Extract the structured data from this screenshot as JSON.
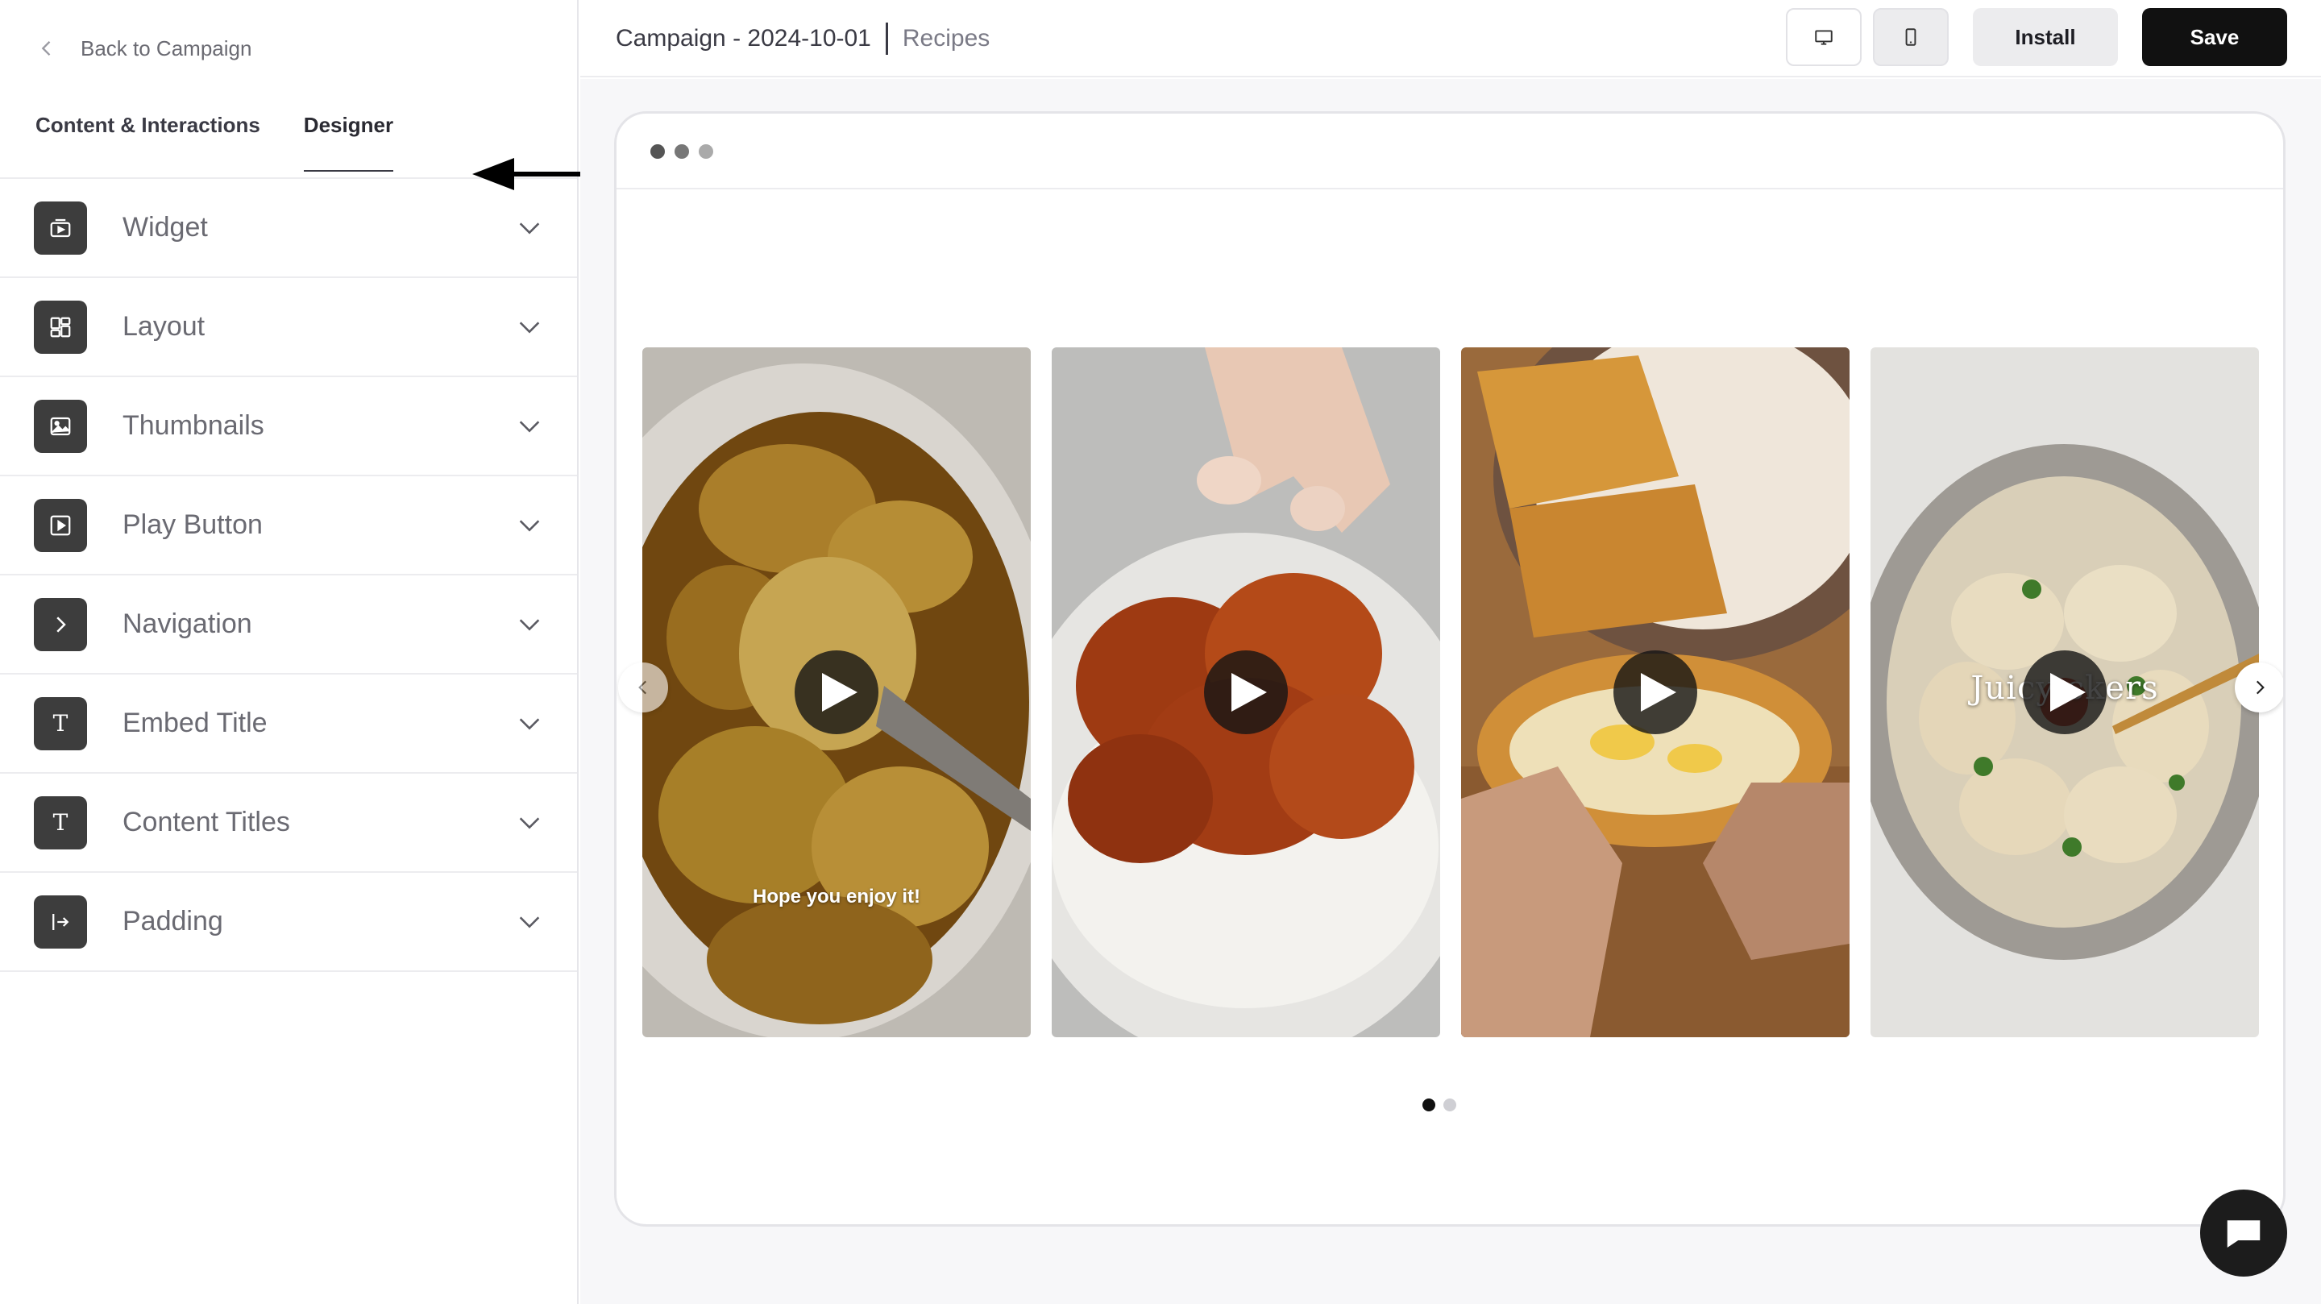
{
  "sidebar": {
    "back_label": "Back to Campaign",
    "tabs": [
      {
        "label": "Content & Interactions",
        "active": false
      },
      {
        "label": "Designer",
        "active": true
      }
    ],
    "items": [
      {
        "label": "Widget",
        "icon": "widget-icon"
      },
      {
        "label": "Layout",
        "icon": "layout-icon"
      },
      {
        "label": "Thumbnails",
        "icon": "thumbnail-icon"
      },
      {
        "label": "Play Button",
        "icon": "play-button-icon"
      },
      {
        "label": "Navigation",
        "icon": "navigation-icon"
      },
      {
        "label": "Embed Title",
        "icon": "text-icon"
      },
      {
        "label": "Content Titles",
        "icon": "text-icon"
      },
      {
        "label": "Padding",
        "icon": "padding-icon"
      }
    ]
  },
  "header": {
    "campaign": "Campaign - 2024-10-01",
    "page": "Recipes",
    "install_label": "Install",
    "save_label": "Save"
  },
  "preview": {
    "cards": [
      {
        "caption": "Hope you enjoy it!",
        "overlay": ""
      },
      {
        "caption": "",
        "overlay": ""
      },
      {
        "caption": "",
        "overlay": ""
      },
      {
        "caption": "",
        "overlay": "Juicy       ckers"
      }
    ],
    "pager": {
      "pages": 2,
      "current": 1
    }
  },
  "colors": {
    "accent_dark": "#111111",
    "menu_icon_bg": "#3d3d3d",
    "muted_text": "#6a6a72"
  }
}
